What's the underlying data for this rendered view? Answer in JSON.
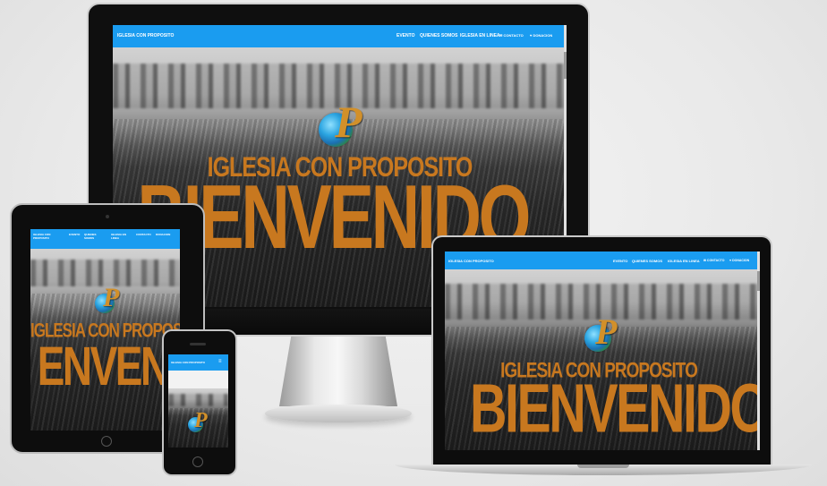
{
  "site": {
    "brand": "IGLESIA CON PROPOSITO",
    "brand_tablet_line1": "IGLESIA CON",
    "brand_tablet_line2": "PROPOSITO",
    "brand_phone": "IGLESIA CON PROPOSITO",
    "nav": [
      {
        "label": "EVENTO"
      },
      {
        "label": "QUIENES SOMOS"
      },
      {
        "label": "IGLESIA EN LINEA"
      },
      {
        "label": "CONTACTO",
        "icon": "envelope-icon"
      },
      {
        "label": "DONACION",
        "icon": "heart-icon"
      }
    ],
    "nav_tablet": [
      {
        "label": "EVENTO"
      },
      {
        "label": "QUIENES SOMOS"
      },
      {
        "label": "IGLESIA EN LINEA"
      },
      {
        "label": "CONTACTO"
      },
      {
        "label": "DONACION"
      }
    ],
    "logo_letter": "P",
    "hero_title": "IGLESIA CON PROPOSITO",
    "hero_welcome": "BIENVENIDO",
    "hero_welcome_partial": "ENVENIDO"
  },
  "colors": {
    "nav_blue": "#1a9cf0",
    "hero_orange": "#c8781f"
  }
}
